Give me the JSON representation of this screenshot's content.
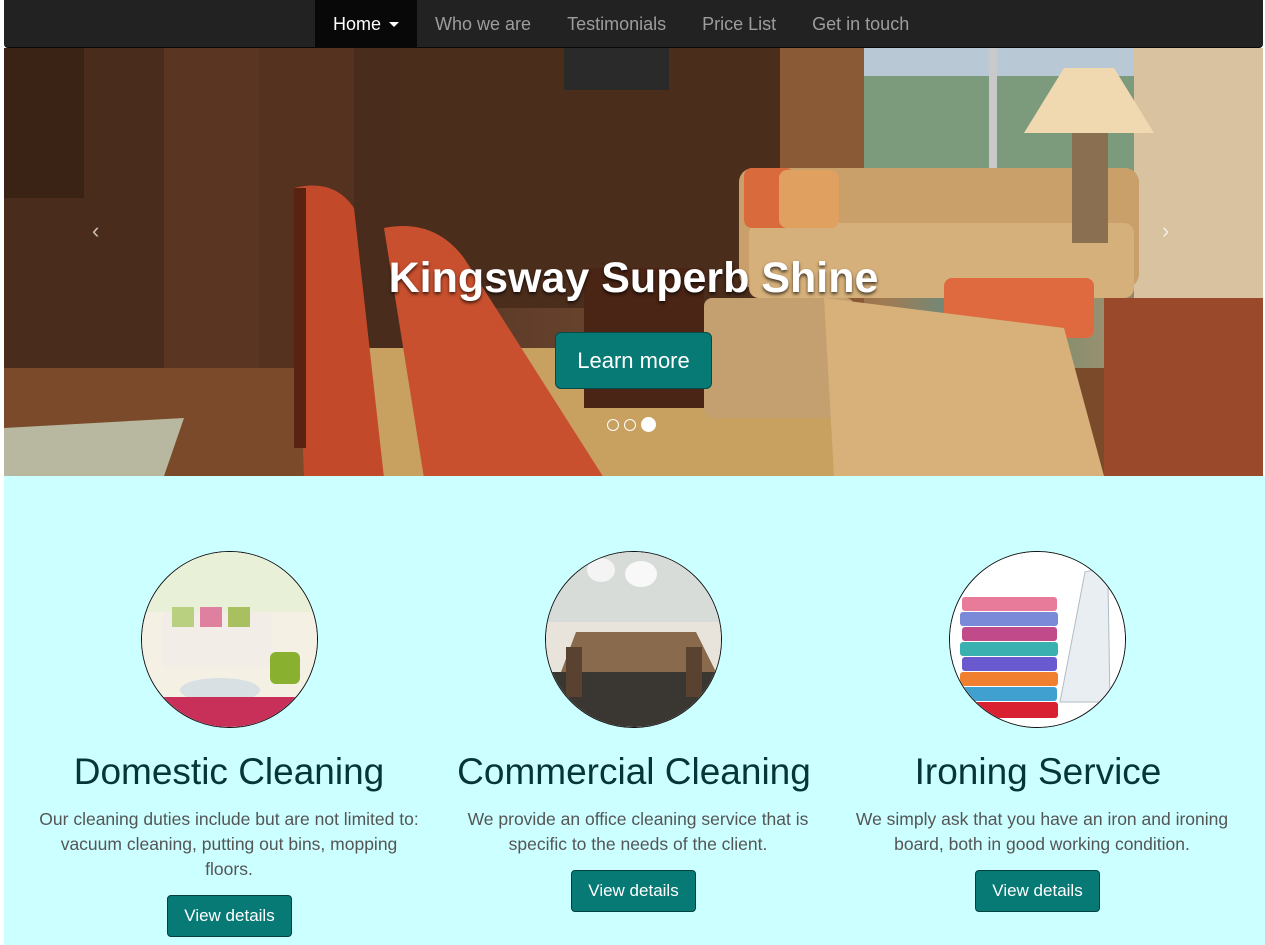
{
  "nav": {
    "items": [
      {
        "label": "Home",
        "active": true,
        "dropdown": true
      },
      {
        "label": "Who we are"
      },
      {
        "label": "Testimonials"
      },
      {
        "label": "Price List"
      },
      {
        "label": "Get in touch"
      }
    ]
  },
  "hero": {
    "title": "Kingsway Superb Shine",
    "button": "Learn more",
    "slides": 3,
    "active_slide": 3,
    "prev_icon": "chevron-left-icon",
    "next_icon": "chevron-right-icon"
  },
  "services": [
    {
      "title": "Domestic Cleaning",
      "text": "Our cleaning duties include but are not limited to: vacuum cleaning, putting out bins, mopping floors.",
      "button": "View details",
      "image": "living-room-photo"
    },
    {
      "title": "Commercial Cleaning",
      "text": "We provide an office cleaning service that is specific to the needs of the client.",
      "button": "View details",
      "image": "dining-room-photo"
    },
    {
      "title": "Ironing Service",
      "text": "We simply ask that you have an iron and ironing board, both in good working condition.",
      "button": "View details",
      "image": "laundry-iron-photo"
    }
  ],
  "colors": {
    "navbar": "#222222",
    "accent": "#077a76",
    "services_bg": "#ccffff",
    "heading": "#063536"
  }
}
